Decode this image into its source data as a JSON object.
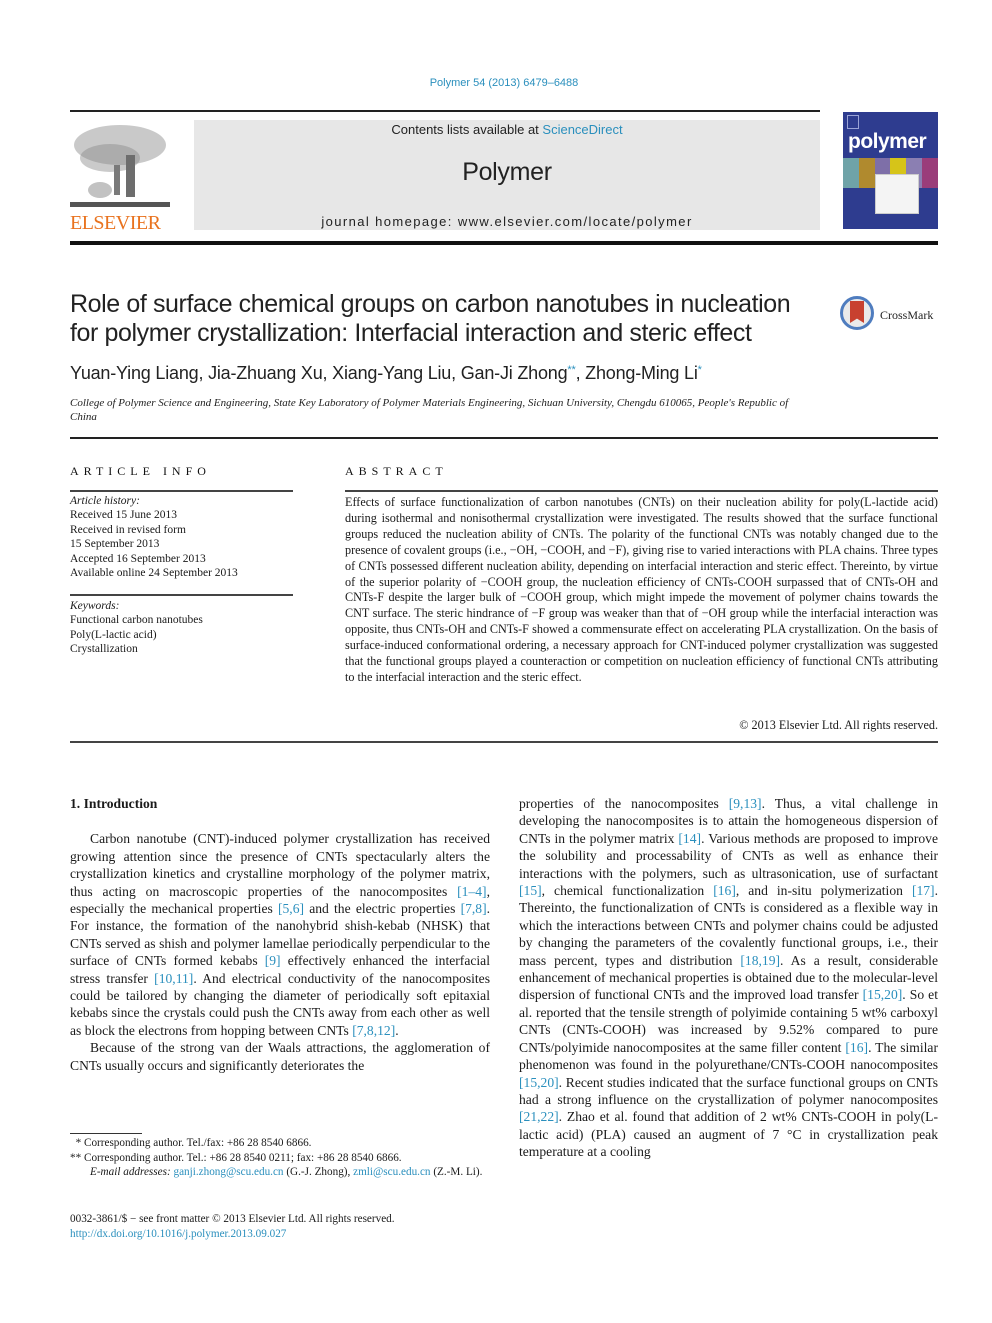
{
  "header": {
    "citation": "Polymer 54 (2013) 6479–6488",
    "contents_prefix": "Contents lists available at ",
    "contents_link": "ScienceDirect",
    "journal_title": "Polymer",
    "homepage_prefix": "journal homepage: ",
    "homepage_url": "www.elsevier.com/locate/polymer",
    "publisher_logo_text": "ELSEVIER",
    "cover_title": "polymer",
    "crossmark_label": "CrossMark"
  },
  "article": {
    "title": "Role of surface chemical groups on carbon nanotubes in nucleation for polymer crystallization: Interfacial interaction and steric effect",
    "authors": [
      {
        "name": "Yuan-Ying Liang",
        "mark": ""
      },
      {
        "name": "Jia-Zhuang Xu",
        "mark": ""
      },
      {
        "name": "Xiang-Yang Liu",
        "mark": ""
      },
      {
        "name": "Gan-Ji Zhong",
        "mark": "**"
      },
      {
        "name": "Zhong-Ming Li",
        "mark": "*"
      }
    ],
    "affiliation": "College of Polymer Science and Engineering, State Key Laboratory of Polymer Materials Engineering, Sichuan University, Chengdu 610065, People's Republic of China"
  },
  "article_info": {
    "heading": "ARTICLE INFO",
    "history_label": "Article history:",
    "history": [
      "Received 15 June 2013",
      "Received in revised form",
      "15 September 2013",
      "Accepted 16 September 2013",
      "Available online 24 September 2013"
    ],
    "keywords_label": "Keywords:",
    "keywords": [
      "Functional carbon nanotubes",
      "Poly(L-lactic acid)",
      "Crystallization"
    ]
  },
  "abstract": {
    "heading": "ABSTRACT",
    "text": "Effects of surface functionalization of carbon nanotubes (CNTs) on their nucleation ability for poly(L-lactide acid) during isothermal and nonisothermal crystallization were investigated. The results showed that the surface functional groups reduced the nucleation ability of CNTs. The polarity of the functional CNTs was notably changed due to the presence of covalent groups (i.e., −OH, −COOH, and −F), giving rise to varied interactions with PLA chains. Three types of CNTs possessed different nucleation ability, depending on interfacial interaction and steric effect. Thereinto, by virtue of the superior polarity of −COOH group, the nucleation efficiency of CNTs-COOH surpassed that of CNTs-OH and CNTs-F despite the larger bulk of −COOH group, which might impede the movement of polymer chains towards the CNT surface. The steric hindrance of −F group was weaker than that of −OH group while the interfacial interaction was opposite, thus CNTs-OH and CNTs-F showed a commensurate effect on accelerating PLA crystallization. On the basis of surface-induced conformational ordering, a necessary approach for CNT-induced polymer crystallization was suggested that the functional groups played a counteraction or competition on nucleation efficiency of functional CNTs attributing to the interfacial interaction and the steric effect.",
    "copyright": "© 2013 Elsevier Ltd. All rights reserved."
  },
  "body": {
    "section_heading": "1.  Introduction",
    "left_paragraphs": [
      [
        {
          "t": "Carbon nanotube (CNT)-induced polymer crystallization has received growing attention since the presence of CNTs spectacularly alters the crystallization kinetics and crystalline morphology of the polymer matrix, thus acting on macroscopic properties of the nanocomposites "
        },
        {
          "ref": "[1–4]"
        },
        {
          "t": ", especially the mechanical properties "
        },
        {
          "ref": "[5,6]"
        },
        {
          "t": " and the electric properties "
        },
        {
          "ref": "[7,8]"
        },
        {
          "t": ". For instance, the formation of the nanohybrid shish-kebab (NHSK) that CNTs served as shish and polymer lamellae periodically perpendicular to the surface of CNTs formed kebabs "
        },
        {
          "ref": "[9]"
        },
        {
          "t": " effectively enhanced the interfacial stress transfer "
        },
        {
          "ref": "[10,11]"
        },
        {
          "t": ". And electrical conductivity of the nanocomposites could be tailored by changing the diameter of periodically soft epitaxial kebabs since the crystals could push the CNTs away from each other as well as block the electrons from hopping between CNTs "
        },
        {
          "ref": "[7,8,12]"
        },
        {
          "t": "."
        }
      ],
      [
        {
          "t": "Because of the strong van der Waals attractions, the agglomeration of CNTs usually occurs and significantly deteriorates the"
        }
      ]
    ],
    "right_paragraphs": [
      [
        {
          "t": "properties of the nanocomposites "
        },
        {
          "ref": "[9,13]"
        },
        {
          "t": ". Thus, a vital challenge in developing the nanocomposites is to attain the homogeneous dispersion of CNTs in the polymer matrix "
        },
        {
          "ref": "[14]"
        },
        {
          "t": ". Various methods are proposed to improve the solubility and processability of CNTs as well as enhance their interactions with the polymers, such as ultrasonication, use of surfactant "
        },
        {
          "ref": "[15]"
        },
        {
          "t": ", chemical functionalization "
        },
        {
          "ref": "[16]"
        },
        {
          "t": ", and in-situ polymerization "
        },
        {
          "ref": "[17]"
        },
        {
          "t": ". Thereinto, the functionalization of CNTs is considered as a flexible way in which the interactions between CNTs and polymer chains could be adjusted by changing the parameters of the covalently functional groups, i.e., their mass percent, types and distribution "
        },
        {
          "ref": "[18,19]"
        },
        {
          "t": ". As a result, considerable enhancement of mechanical properties is obtained due to the molecular-level dispersion of functional CNTs and the improved load transfer "
        },
        {
          "ref": "[15,20]"
        },
        {
          "t": ". So et al. reported that the tensile strength of polyimide containing 5 wt% carboxyl CNTs (CNTs-COOH) was increased by 9.52% compared to pure CNTs/polyimide nanocomposites at the same filler content "
        },
        {
          "ref": "[16]"
        },
        {
          "t": ". The similar phenomenon was found in the polyurethane/CNTs-COOH nanocomposites "
        },
        {
          "ref": "[15,20]"
        },
        {
          "t": ". Recent studies indicated that the surface functional groups on CNTs had a strong influence on the crystallization of polymer nanocomposites "
        },
        {
          "ref": "[21,22]"
        },
        {
          "t": ". Zhao et al. found that addition of 2 wt% CNTs-COOH in poly(L-lactic acid) (PLA) caused an augment of 7 °C in crystallization peak temperature at a cooling"
        }
      ]
    ]
  },
  "footnotes": {
    "fn1_mark": "*",
    "fn1_text": "Corresponding author. Tel./fax: +86 28 8540 6866.",
    "fn2_mark": "**",
    "fn2_text": "Corresponding author. Tel.: +86 28 8540 0211; fax: +86 28 8540 6866.",
    "email_label": "E-mail addresses:",
    "email1": "ganji.zhong@scu.edu.cn",
    "email1_owner": "(G.-J. Zhong),",
    "email2": "zmli@scu.edu.cn",
    "email2_owner": "(Z.-M. Li).",
    "front_matter": "0032-3861/$ − see front matter © 2013 Elsevier Ltd. All rights reserved.",
    "doi": "http://dx.doi.org/10.1016/j.polymer.2013.09.027"
  },
  "colors": {
    "link": "#2a8fbd",
    "elsevier_orange": "#e9731f",
    "cover_blue": "#2e3c8f",
    "masthead_gray": "#e7e7e7"
  }
}
